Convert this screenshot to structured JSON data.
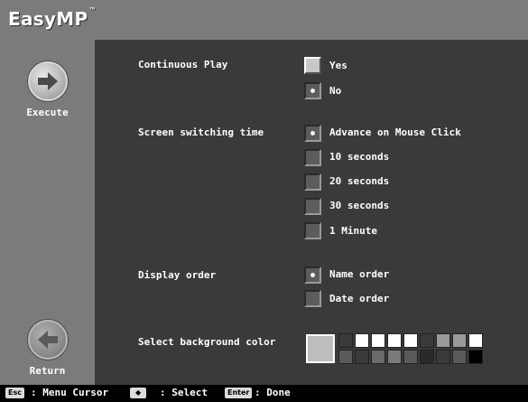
{
  "app": {
    "logo": "EasyMP",
    "trademark": "™"
  },
  "sidebar": {
    "execute_label": "Execute",
    "return_label": "Return"
  },
  "settings": {
    "continuous_play": {
      "label": "Continuous Play",
      "options": [
        {
          "label": "Yes",
          "selected": false
        },
        {
          "label": "No",
          "selected": true
        }
      ]
    },
    "screen_switching": {
      "label": "Screen switching time",
      "options": [
        {
          "label": "Advance on Mouse Click",
          "selected": true
        },
        {
          "label": "10 seconds",
          "selected": false
        },
        {
          "label": "20 seconds",
          "selected": false
        },
        {
          "label": "30 seconds",
          "selected": false
        },
        {
          "label": "1 Minute",
          "selected": false
        }
      ]
    },
    "display_order": {
      "label": "Display order",
      "options": [
        {
          "label": "Name order",
          "selected": true
        },
        {
          "label": "Date order",
          "selected": false
        }
      ]
    },
    "background_color": {
      "label": "Select background color",
      "selected_color": "#bdbdbd",
      "swatches": [
        "#3a3a3a",
        "#ffffff",
        "#ffffff",
        "#ffffff",
        "#ffffff",
        "#3a3a3a",
        "#9a9a9a",
        "#9a9a9a",
        "#ffffff",
        "#5a5a5a",
        "#3a3a3a",
        "#6a6a6a",
        "#7a7a7a",
        "#5a5a5a",
        "#2a2a2a",
        "#3a3a3a",
        "#5a5a5a",
        "#000000"
      ]
    }
  },
  "footer": {
    "esc_key": "Esc",
    "esc_text": ": Menu Cursor",
    "arrow_key": "◆",
    "arrow_text": ": Select",
    "enter_key": "Enter",
    "enter_text": ": Done"
  }
}
